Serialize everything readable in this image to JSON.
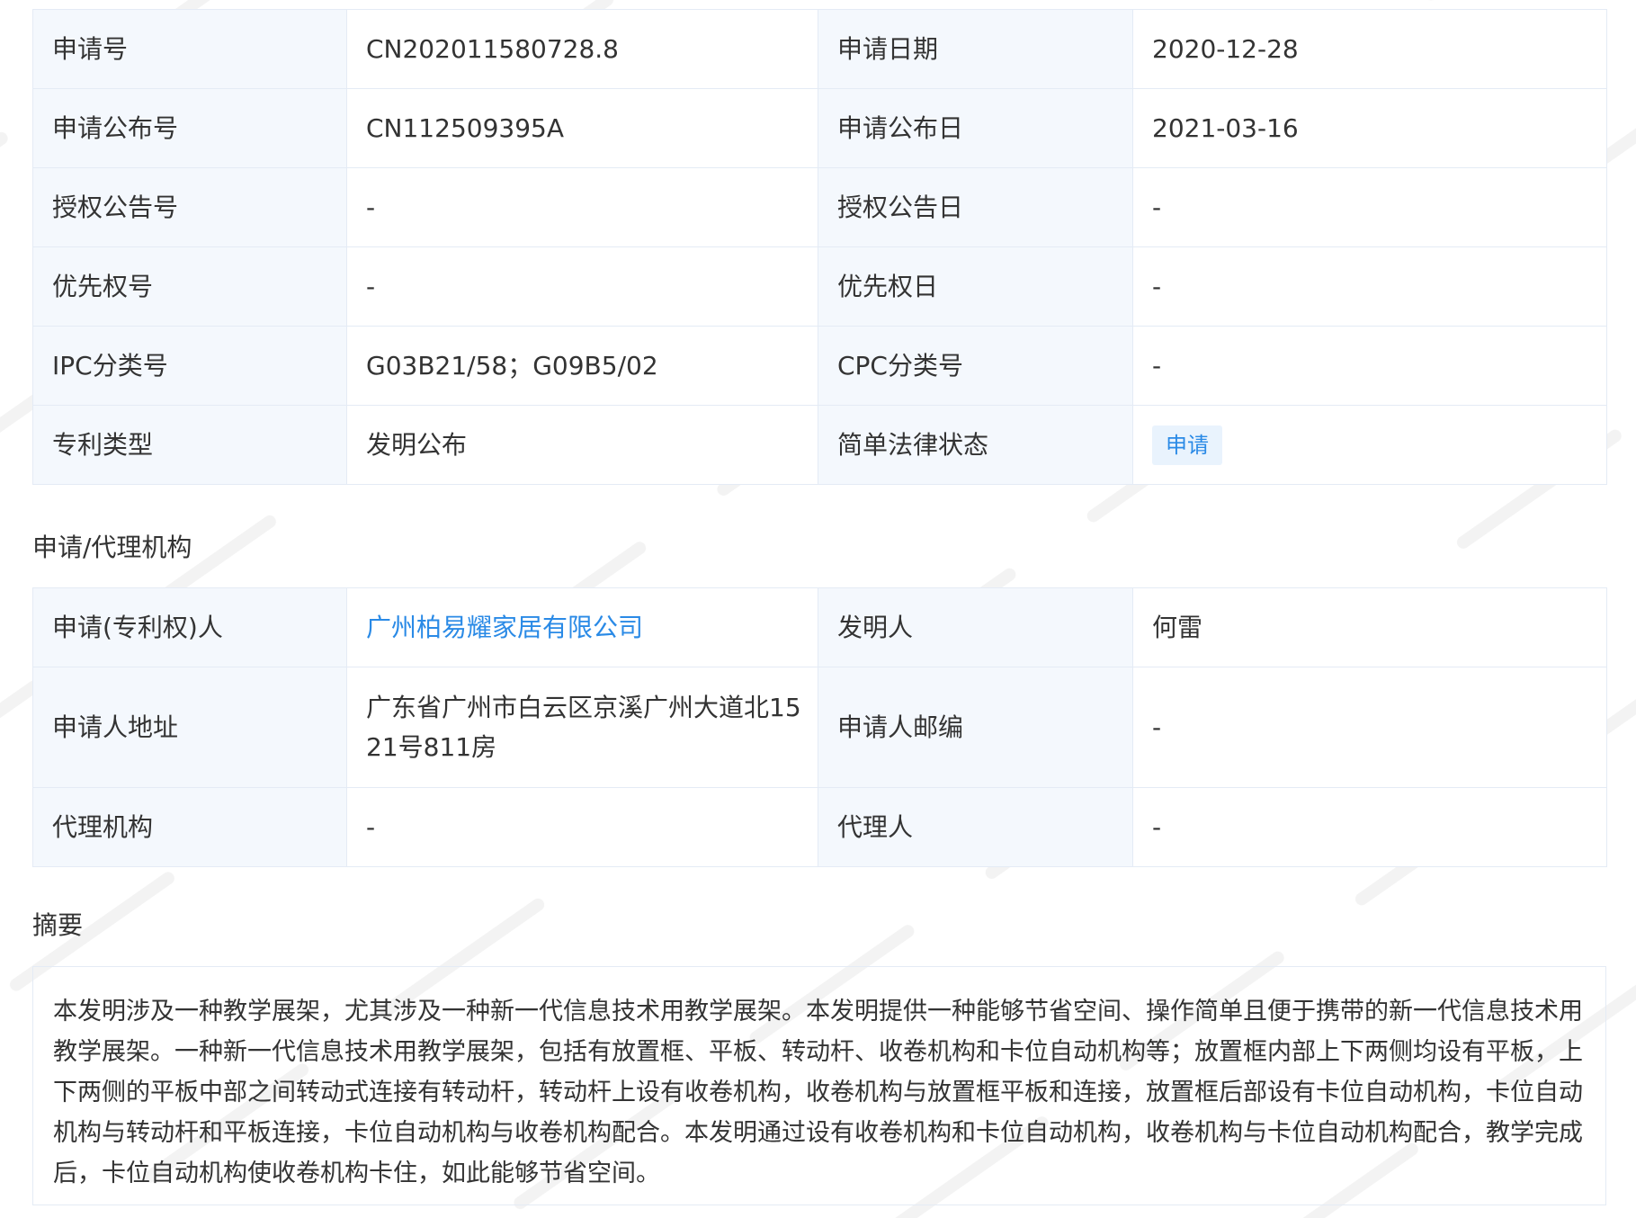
{
  "basic_info": {
    "rows": [
      {
        "label1": "申请号",
        "value1": "CN202011580728.8",
        "label2": "申请日期",
        "value2": "2020-12-28"
      },
      {
        "label1": "申请公布号",
        "value1": "CN112509395A",
        "label2": "申请公布日",
        "value2": "2021-03-16"
      },
      {
        "label1": "授权公告号",
        "value1": "-",
        "label2": "授权公告日",
        "value2": "-"
      },
      {
        "label1": "优先权号",
        "value1": "-",
        "label2": "优先权日",
        "value2": "-"
      },
      {
        "label1": "IPC分类号",
        "value1": "G03B21/58；G09B5/02",
        "label2": "CPC分类号",
        "value2": "-"
      },
      {
        "label1": "专利类型",
        "value1": "发明公布",
        "label2": "简单法律状态",
        "value2": "申请"
      }
    ],
    "status_badge_color": "#2a8ae6"
  },
  "agency": {
    "section_title": "申请/代理机构",
    "rows": [
      {
        "label1": "申请(专利权)人",
        "value1": "广州柏易耀家居有限公司",
        "label2": "发明人",
        "value2": "何雷"
      },
      {
        "label1": "申请人地址",
        "value1": "广东省广州市白云区京溪广州大道北1521号811房",
        "label2": "申请人邮编",
        "value2": "-"
      },
      {
        "label1": "代理机构",
        "value1": "-",
        "label2": "代理人",
        "value2": "-"
      }
    ]
  },
  "abstract": {
    "section_title": "摘要",
    "text": "本发明涉及一种教学展架，尤其涉及一种新一代信息技术用教学展架。本发明提供一种能够节省空间、操作简单且便于携带的新一代信息技术用教学展架。一种新一代信息技术用教学展架，包括有放置框、平板、转动杆、收卷机构和卡位自动机构等；放置框内部上下两侧均设有平板，上下两侧的平板中部之间转动式连接有转动杆，转动杆上设有收卷机构，收卷机构与放置框平板和连接，放置框后部设有卡位自动机构，卡位自动机构与转动杆和平板连接，卡位自动机构与收卷机构配合。本发明通过设有收卷机构和卡位自动机构，收卷机构与卡位自动机构配合，教学完成后，卡位自动机构使收卷机构卡住，如此能够节省空间。"
  },
  "colors": {
    "label_bg": "#f4f8fd",
    "border": "#e4ebf5",
    "link": "#2a8ae6",
    "text": "#333333"
  }
}
